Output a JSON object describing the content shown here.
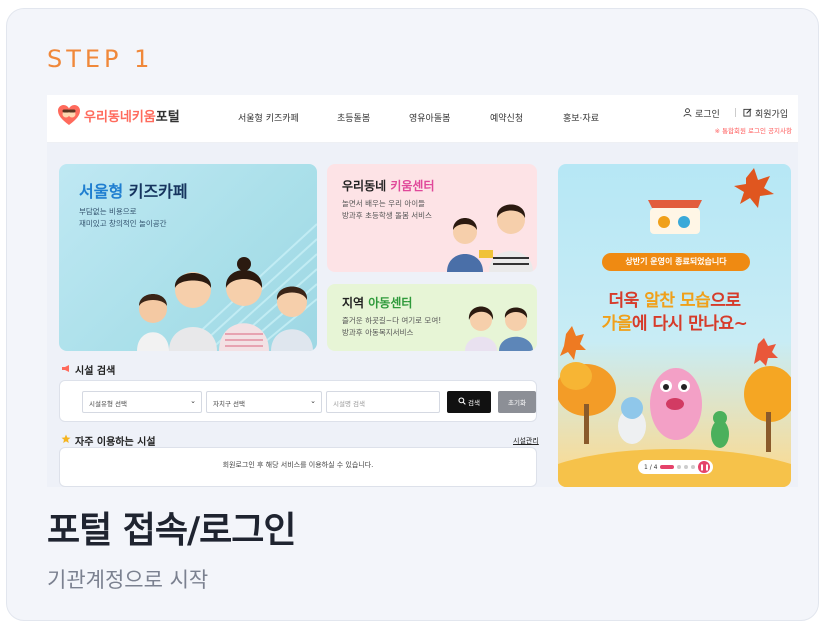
{
  "step_label": "STEP 1",
  "title": "포털 접속/로그인",
  "description": "기관계정으로 시작",
  "screenshot": {
    "logo": {
      "part1": "우리동네",
      "part2": "키움",
      "part3": "포털"
    },
    "nav": [
      "서울형 키즈카페",
      "초등돌봄",
      "영유아돌봄",
      "예약신청",
      "홍보·자료"
    ],
    "util": {
      "login": "로그인",
      "signup": "회원가입"
    },
    "notice": "※ 통합회원 로그인 공지사항",
    "kidscafe": {
      "title_a": "서울형",
      "title_b": " 키즈카페",
      "sub1": "부담없는 비용으로",
      "sub2": "재미있고 창의적인 놀이공간"
    },
    "kium": {
      "title_a": "우리동네 ",
      "title_b": "키움센터",
      "sub1": "놀면서 배우는 우리 아이들",
      "sub2": "방과후 초등학생 돌봄 서비스"
    },
    "child": {
      "title_a": "지역 ",
      "title_b": "아동센터",
      "sub1": "즐거운 하굣길~다 여기로 모여!",
      "sub2": "방과후 아동복지서비스"
    },
    "search": {
      "title": "시설 검색",
      "select1": "시설유형 선택",
      "select2": "자치구 선택",
      "input_placeholder": "시설명 검색",
      "search_btn": "검색",
      "reset_btn": "초기화"
    },
    "favorites": {
      "title": "자주 이용하는 시설",
      "link": "시설관리",
      "message": "회원로그인 후 해당 서비스를 이용하실 수 있습니다."
    },
    "banner": {
      "pill": "상반기 운영이 종료되었습니다",
      "line1_a": "더욱 ",
      "line1_b": "알찬 모습",
      "line1_c": "으로",
      "line2_a": "가을",
      "line2_b": "에 다시 만나요~",
      "page": "1 / 4"
    }
  },
  "colors": {
    "accent": "#f0883a",
    "title": "#1f2430",
    "desc": "#7b8190"
  }
}
